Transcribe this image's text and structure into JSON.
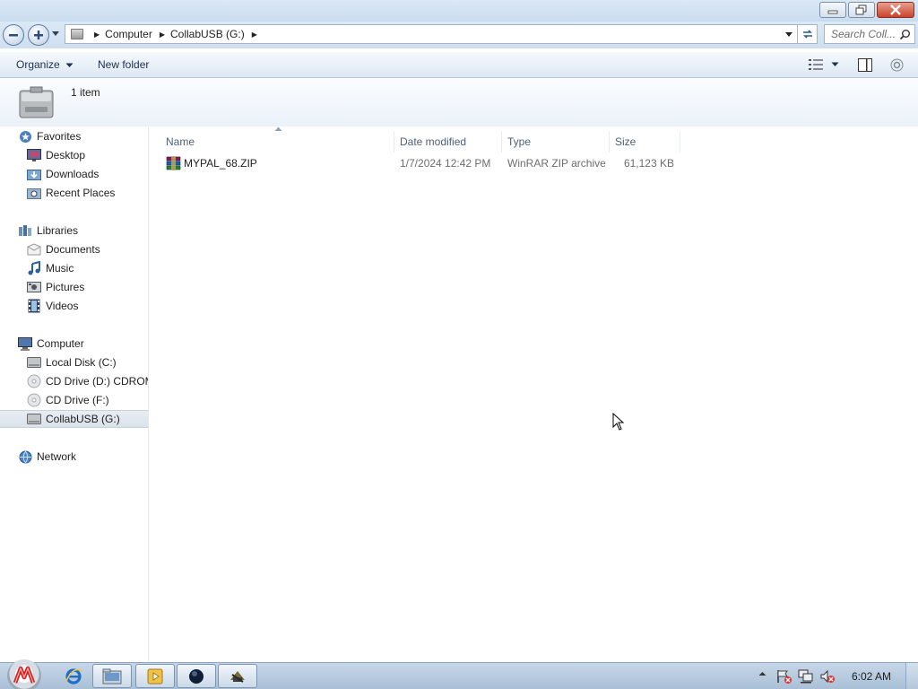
{
  "window": {
    "buttons": {
      "minimize": "minimize-icon",
      "restore": "restore-icon",
      "close": "close-icon"
    }
  },
  "address": {
    "crumbs": [
      "Computer",
      "CollabUSB (G:)"
    ],
    "search_placeholder": "Search Coll..."
  },
  "toolbar": {
    "organize_label": "Organize",
    "new_folder_label": "New folder"
  },
  "info": {
    "item_count": "1 item"
  },
  "nav": {
    "favorites": {
      "label": "Favorites",
      "items": [
        "Desktop",
        "Downloads",
        "Recent Places"
      ]
    },
    "libraries": {
      "label": "Libraries",
      "items": [
        "Documents",
        "Music",
        "Pictures",
        "Videos"
      ]
    },
    "computer": {
      "label": "Computer",
      "items": [
        "Local Disk (C:)",
        "CD Drive (D:) CDROM",
        "CD Drive (F:)",
        "CollabUSB (G:)"
      ]
    },
    "network": {
      "label": "Network"
    }
  },
  "columns": [
    "Name",
    "Date modified",
    "Type",
    "Size"
  ],
  "files": [
    {
      "name": "MYPAL_68.ZIP",
      "date": "1/7/2024 12:42 PM",
      "type": "WinRAR ZIP archive",
      "size": "61,123 KB"
    }
  ],
  "taskbar": {
    "clock": "6:02 AM"
  },
  "colors": {
    "accent": "#4c607a",
    "title_bar": "#dbe8f5",
    "taskbar": "#b8cce0",
    "close_button": "#c9432c"
  }
}
